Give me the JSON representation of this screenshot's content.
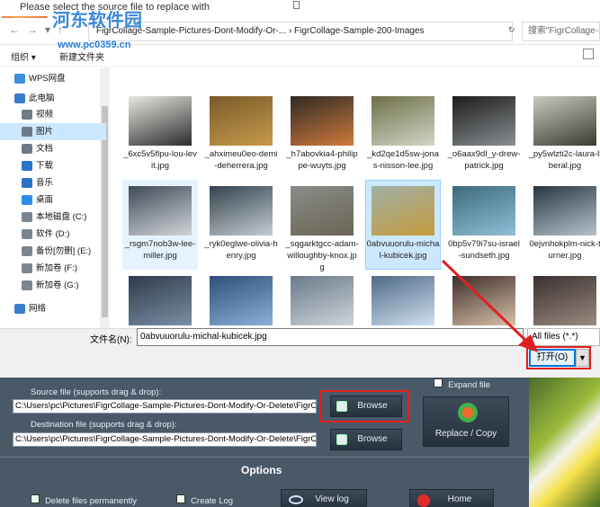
{
  "dialog": {
    "title": "Please select the source file to replace with",
    "address_path": "FigrCollage-Sample-Pictures-Dont-Modify-Or-...  ›  FigrCollage-Sample-200-Images",
    "search_placeholder": "搜索\"FigrCollage-Sa...",
    "toolbar": {
      "organize": "组织 ▾",
      "new_folder": "新建文件夹"
    },
    "sidebar": [
      {
        "label": "WPS网盘",
        "icon": "cloud-icon",
        "color": "#3c8fdc"
      },
      {
        "label": "此电脑",
        "icon": "computer-icon",
        "color": "#3a7ecb"
      },
      {
        "label": "视频",
        "icon": "video-folder-icon",
        "color": "#6d7b8a"
      },
      {
        "label": "图片",
        "icon": "pictures-folder-icon",
        "color": "#6d7b8a",
        "selected": true
      },
      {
        "label": "文档",
        "icon": "documents-folder-icon",
        "color": "#6d7b8a"
      },
      {
        "label": "下载",
        "icon": "download-icon",
        "color": "#2b73c9"
      },
      {
        "label": "音乐",
        "icon": "music-icon",
        "color": "#2b73c9"
      },
      {
        "label": "桌面",
        "icon": "desktop-icon",
        "color": "#2b8ee6"
      },
      {
        "label": "本地磁盘 (C:)",
        "icon": "drive-icon",
        "color": "#7a8590"
      },
      {
        "label": "软件 (D:)",
        "icon": "drive-icon",
        "color": "#7a8590"
      },
      {
        "label": "备份[勿删] (E:)",
        "icon": "drive-icon",
        "color": "#7a8590"
      },
      {
        "label": "新加卷 (F:)",
        "icon": "drive-icon",
        "color": "#7a8590"
      },
      {
        "label": "新加卷 (G:)",
        "icon": "drive-icon",
        "color": "#7a8590"
      },
      {
        "label": "网络",
        "icon": "network-icon",
        "color": "#3a7ecb"
      }
    ],
    "files": [
      {
        "name": "_6xc5v5flpu-lou-levit.jpg",
        "c1": "#e9e7e0",
        "c2": "#2a2c2e"
      },
      {
        "name": "_ahximeu0eo-demi-deherrera.jpg",
        "c1": "#7a5a2a",
        "c2": "#c79a4b"
      },
      {
        "name": "_h7abovkia4-philippe-wuyts.jpg",
        "c1": "#2e2a26",
        "c2": "#d07a3a"
      },
      {
        "name": "_kd2qe1d5sw-jonas-nisson-lee.jpg",
        "c1": "#6d7048",
        "c2": "#d3d5c6"
      },
      {
        "name": "_o6aax9dl_y-drew-patrick.jpg",
        "c1": "#1c1c1c",
        "c2": "#8a8f92"
      },
      {
        "name": "_py5wlzti2c-laura-liberal.jpg",
        "c1": "#c9c9c0",
        "c2": "#3b3b30"
      },
      {
        "name": "_rsgm7nob3w-lee-miller.jpg",
        "c1": "#3f4a56",
        "c2": "#d2d6da",
        "highlight": true
      },
      {
        "name": "_ryk0eglwe-olivia-henry.jpg",
        "c1": "#33434f",
        "c2": "#c4ccd0"
      },
      {
        "name": "_sqgarktgcc-adam-willoughby-knox.jpg",
        "c1": "#8a8c88",
        "c2": "#6a6555"
      },
      {
        "name": "0abvuuorulu-michal-kubicek.jpg",
        "c1": "#9fb0a6",
        "c2": "#c69b3c",
        "selected": true
      },
      {
        "name": "0bp5v79i7su-israel-sundseth.jpg",
        "c1": "#3d6a7b",
        "c2": "#8fc0d8"
      },
      {
        "name": "0ejvnhokplm-nick-turner.jpg",
        "c1": "#2a3640",
        "c2": "#b6c3cc"
      },
      {
        "name": "",
        "c1": "#2e3a4a",
        "c2": "#7b8fa6"
      },
      {
        "name": "",
        "c1": "#2f4f7a",
        "c2": "#8ab0d8"
      },
      {
        "name": "",
        "c1": "#6a7a8a",
        "c2": "#cdd4d8"
      },
      {
        "name": "",
        "c1": "#4f6a86",
        "c2": "#cfe0ef"
      },
      {
        "name": "",
        "c1": "#3f2e2a",
        "c2": "#d8c0a8"
      },
      {
        "name": "",
        "c1": "#3a3030",
        "c2": "#9a8a80"
      }
    ],
    "filename_label": "文件名(N):",
    "filename_value": "0abvuuorulu-michal-kubicek.jpg",
    "filter_value": "All files (*.*)",
    "open_label": "打开(O)",
    "open_dropdown": "▼"
  },
  "watermark": {
    "title": "河东软件园",
    "url": "www.pc0359.cn"
  },
  "app": {
    "source_label": "Source file (supports drag & drop):",
    "source_value": "C:\\Users\\pc\\Pictures\\FigrCollage-Sample-Pictures-Dont-Modify-Or-Delete\\FigrC",
    "dest_label": "Destination file (supports drag & drop):",
    "dest_value": "C:\\Users\\pc\\Pictures\\FigrCollage-Sample-Pictures-Dont-Modify-Or-Delete\\FigrC",
    "browse_label": "Browse",
    "expand_label": "Expand file",
    "replace_label": "Replace / Copy",
    "options_title": "Options",
    "delete_label": "Delete files permanently",
    "create_log_label": "Create Log",
    "view_log_label": "View log",
    "home_label": "Home"
  }
}
